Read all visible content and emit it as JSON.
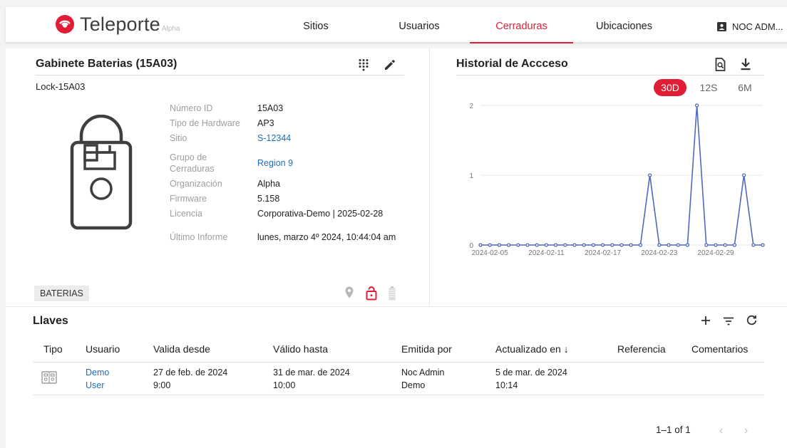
{
  "brand": {
    "name": "Teleporte",
    "sub": "Alpha"
  },
  "nav": {
    "tabs": [
      {
        "label": "Sitios"
      },
      {
        "label": "Usuarios"
      },
      {
        "label": "Cerraduras"
      },
      {
        "label": "Ubicaciones"
      }
    ],
    "active_tab": "Cerraduras",
    "user": "NOC ADM..."
  },
  "lock": {
    "title": "Gabinete Baterias (15A03)",
    "id": "Lock-15A03",
    "props": [
      {
        "label": "Número ID",
        "value": "15A03"
      },
      {
        "label": "Tipo de Hardware",
        "value": "AP3"
      },
      {
        "label": "Sitio",
        "value": "S-12344"
      },
      {
        "label": "Grupo de Cerraduras",
        "value": "Region 9"
      },
      {
        "label": "Organización",
        "value": "Alpha"
      },
      {
        "label": "Firmware",
        "value": "5.158"
      },
      {
        "label": "Licencia",
        "value": "Corporativa-Demo | 2025-02-28"
      },
      {
        "label": "Último Informe",
        "value": "lunes, marzo 4º 2024, 10:44:04 am"
      }
    ],
    "tag": "BATERIAS",
    "status_icons": [
      "location-pin-icon",
      "unlocked-padlock-icon",
      "battery-icon"
    ],
    "colors": {
      "accent": "#e01d35",
      "link": "#1f6fb8"
    }
  },
  "history": {
    "title": "Historial de Accceso",
    "ranges": [
      "30D",
      "12S",
      "6M"
    ],
    "active_range": "30D"
  },
  "chart_data": {
    "type": "line",
    "title": "",
    "x": [
      "2024-02-04",
      "2024-02-05",
      "2024-02-06",
      "2024-02-07",
      "2024-02-08",
      "2024-02-09",
      "2024-02-10",
      "2024-02-11",
      "2024-02-12",
      "2024-02-13",
      "2024-02-14",
      "2024-02-15",
      "2024-02-16",
      "2024-02-17",
      "2024-02-18",
      "2024-02-19",
      "2024-02-20",
      "2024-02-21",
      "2024-02-22",
      "2024-02-23",
      "2024-02-24",
      "2024-02-25",
      "2024-02-26",
      "2024-02-27",
      "2024-02-28",
      "2024-02-29",
      "2024-03-01",
      "2024-03-02",
      "2024-03-03",
      "2024-03-04",
      "2024-03-05"
    ],
    "series": [
      {
        "values": [
          0,
          0,
          0,
          0,
          0,
          0,
          0,
          0,
          0,
          0,
          0,
          0,
          0,
          0,
          0,
          0,
          0,
          0,
          1,
          0,
          0,
          0,
          0,
          2,
          0,
          0,
          0,
          0,
          1,
          0,
          0
        ]
      }
    ],
    "x_ticks": [
      "2024-02-05",
      "2024-02-11",
      "2024-02-17",
      "2024-02-23",
      "2024-02-29"
    ],
    "y_ticks": [
      0,
      1,
      2
    ],
    "ylim": [
      0,
      2
    ],
    "grid": true,
    "color": "#4f68be"
  },
  "keys": {
    "title": "Llaves",
    "columns": [
      "Tipo",
      "Usuario",
      "Valida desde",
      "Válido hasta",
      "Emitida por",
      "Actualizado en ↓",
      "Referencia",
      "Comentarios"
    ],
    "rows": [
      {
        "tipo_icon": "key-card-icon",
        "usuario": [
          "Demo",
          "User"
        ],
        "valida_desde": [
          "27 de feb. de 2024",
          "9:00"
        ],
        "valido_hasta": [
          "31 de mar. de 2024",
          "10:00"
        ],
        "emitida_por": [
          "Noc Admin",
          "Demo"
        ],
        "actualizado_en": [
          "5 de mar. de 2024",
          "10:14"
        ],
        "referencia": "",
        "comentarios": ""
      }
    ],
    "pager": "1–1 of 1"
  }
}
